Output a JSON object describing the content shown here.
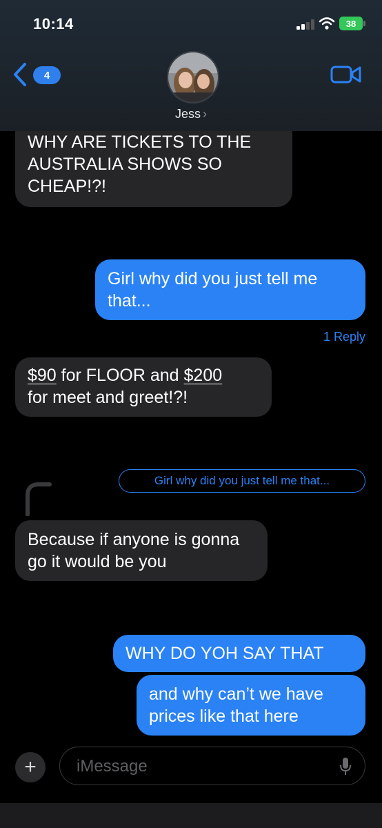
{
  "status_bar": {
    "time": "10:14",
    "battery": "38"
  },
  "header": {
    "back_count": "4",
    "contact_name": "Jess",
    "contact_chevron": "›"
  },
  "messages": [
    {
      "side": "in",
      "lines": [
        "WHY ARE TICKETS TO THE",
        "AUSTRALIA SHOWS SO",
        "CHEAP!?!"
      ]
    },
    {
      "side": "out",
      "lines": [
        "Girl why did you just tell me",
        "that..."
      ]
    },
    {
      "side": "in",
      "parts": [
        "$90",
        " for FLOOR and ",
        "$200",
        "for meet and greet!?!"
      ]
    },
    {
      "side": "in",
      "lines": [
        "Because if anyone is gonna",
        "go it would be you"
      ]
    },
    {
      "side": "out",
      "lines": [
        "WHY DO YOH SAY THAT"
      ]
    },
    {
      "side": "out",
      "lines": [
        "and why can’t we have",
        "prices like that here"
      ]
    }
  ],
  "thread": {
    "reply_count": "1 Reply",
    "quoted_text": "Girl why did you just tell me that..."
  },
  "composer": {
    "plus": "+",
    "placeholder": "iMessage"
  },
  "colors": {
    "outgoing": "#2a82f5",
    "incoming": "#262629",
    "accent": "#2a82f5"
  }
}
